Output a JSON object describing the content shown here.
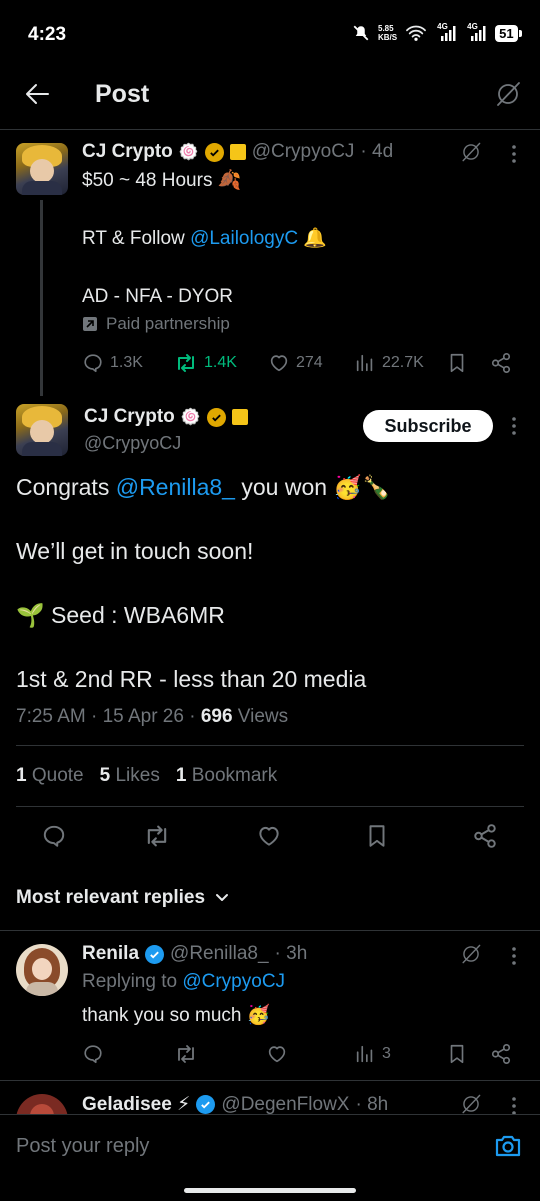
{
  "status_bar": {
    "time": "4:23",
    "net_speed_top": "5.85",
    "net_speed_bottom": "KB/S",
    "sim1": "4G",
    "sim2": "4G",
    "battery": "51"
  },
  "header": {
    "title": "Post"
  },
  "quoted_post": {
    "author": "CJ Crypto",
    "handle": "@CrypyoCJ",
    "time": "· 4d",
    "line1": "$50 ~ 48 Hours 🍂",
    "line2_prefix": "RT & Follow ",
    "line2_mention": "@LailologyC",
    "line2_suffix": " 🔔",
    "line3": "AD - NFA - DYOR",
    "paid": "Paid partnership",
    "replies": "1.3K",
    "reposts": "1.4K",
    "likes": "274",
    "views": "22.7K"
  },
  "main_post": {
    "author": "CJ Crypto",
    "handle": "@CrypyoCJ",
    "subscribe": "Subscribe",
    "p1_prefix": "Congrats ",
    "p1_mention": "@Renilla8_",
    "p1_suffix": " you won 🥳🍾",
    "p2": "We’ll get in touch soon!",
    "p3": "🌱 Seed : WBA6MR",
    "p4": "1st & 2nd RR - less than 20 media",
    "timestamp": "7:25 AM · 15 Apr 26 · ",
    "views_count": "696",
    "views_label": " Views",
    "quotes_count": "1",
    "quotes_label": " Quote",
    "likes_count": "5",
    "likes_label": " Likes",
    "bookmarks_count": "1",
    "bookmarks_label": " Bookmark"
  },
  "replies_header": {
    "label": "Most relevant replies"
  },
  "reply1": {
    "author": "Renila",
    "handle": "@Renilla8_",
    "time": "· 3h",
    "replying_to_label": "Replying to ",
    "replying_to": "@CrypyoCJ",
    "text": "thank you so much 🥳",
    "views": "3"
  },
  "reply2": {
    "author": "Geladisee ⚡",
    "handle": "@DegenFlowX",
    "time": "· 8h"
  },
  "composer": {
    "placeholder": "Post your reply"
  }
}
